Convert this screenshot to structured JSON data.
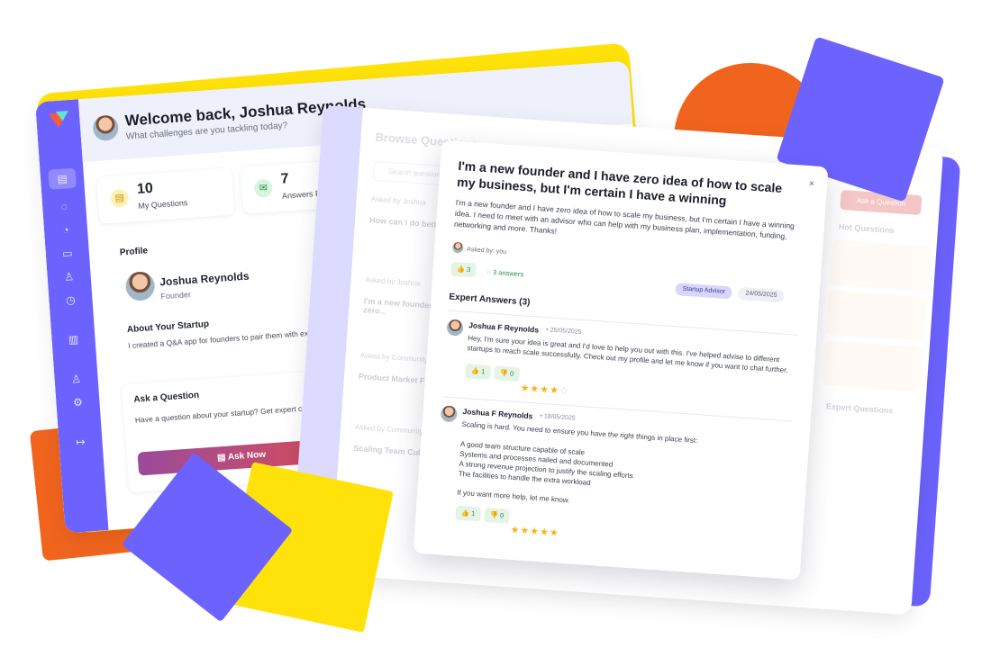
{
  "colors": {
    "brand_purple": "#6c63ff",
    "brand_orange": "#f0641e",
    "brand_yellow": "#ffe20a",
    "accent_green": "#2c8a49",
    "star_gold": "#f6b31b"
  },
  "dashboard": {
    "welcome_title": "Welcome back, Joshua Reynolds",
    "welcome_subtitle": "What challenges are you tackling today?",
    "stats": [
      {
        "value": "10",
        "label": "My Questions",
        "icon": "document-icon"
      },
      {
        "value": "7",
        "label": "Answers Re",
        "icon": "mail-icon"
      }
    ],
    "profile_section": "Profile",
    "profile_name": "Joshua Reynolds",
    "profile_role": "Founder",
    "about_title": "About Your Startup",
    "about_text": "I created a Q&A app for founders to pair them with ex",
    "ask_title": "Ask a Question",
    "ask_text": "Have a question about your startup? Get expert community.",
    "ask_button": "Ask Now"
  },
  "browse": {
    "title": "Browse Questions",
    "search_placeholder": "Search questions...",
    "items": [
      {
        "meta": "Asked by Joshua",
        "title": "How can I do better at..."
      },
      {
        "meta": "Asked by Joshua",
        "title": "I'm a new founder and I have zero..."
      },
      {
        "meta": "Asked by Community",
        "title": "Product Market Fit"
      },
      {
        "meta": "Asked by Community",
        "title": "Scaling Team Culture"
      }
    ],
    "ask_button": "Ask a Question",
    "hot_title": "Hot Questions",
    "expert_title": "Expert Questions"
  },
  "question": {
    "title": "I'm a new founder and I have zero idea of how to scale my business, but I'm certain I have a winning",
    "body": "I'm a new founder and I have zero idea of how to scale my business, but I'm certain I have a winning idea. I need to meet with an advisor who can help with my business plan, implementation, funding, networking and more. Thanks!",
    "asked_by": "Asked by: you",
    "likes": "3",
    "answers_count": "3 answers",
    "tag": "Startup Advisor",
    "date": "24/05/2025",
    "close": "×",
    "expert_answers_title": "Expert Answers (3)"
  },
  "answers": [
    {
      "name": "Joshua F Reynolds",
      "date": "• 25/05/2025",
      "text": "Hey, I'm sure your idea is great and I'd love to help you out with this. I've helped advise to different startups to reach scale successfully. Check out my profile and let me know if you want to chat further.",
      "likes": "1",
      "dislikes": "0",
      "rating": 4
    },
    {
      "name": "Joshua F Reynolds",
      "date": "• 18/05/2025",
      "intro": "Scaling is hard. You need to ensure you have the right things in place first:",
      "points": [
        "A good team structure capable of scale",
        "Systems and processes nailed and documented",
        "A strong revenue projection to justify the scaling efforts",
        "The facilities to handle the extra workload"
      ],
      "closing": "If you want more help, let me know.",
      "likes": "1",
      "dislikes": "0",
      "rating": 5
    }
  ]
}
